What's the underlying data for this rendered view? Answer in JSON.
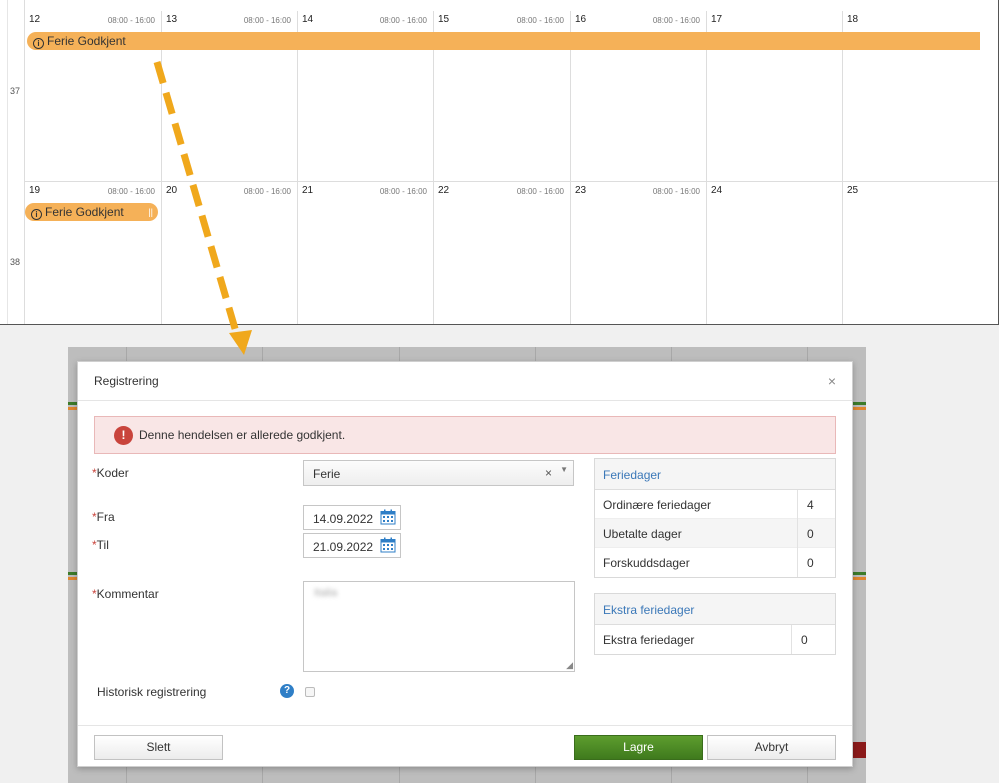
{
  "calendar": {
    "weeks": [
      {
        "number": "37",
        "days": [
          {
            "day": "12",
            "hours": "08:00 - 16:00"
          },
          {
            "day": "13",
            "hours": "08:00 - 16:00"
          },
          {
            "day": "14",
            "hours": "08:00 - 16:00"
          },
          {
            "day": "15",
            "hours": "08:00 - 16:00"
          },
          {
            "day": "16",
            "hours": "08:00 - 16:00"
          },
          {
            "day": "17",
            "hours": ""
          },
          {
            "day": "18",
            "hours": ""
          }
        ],
        "event": {
          "label": "Ferie Godkjent",
          "icon": "info-icon"
        }
      },
      {
        "number": "38",
        "days": [
          {
            "day": "19",
            "hours": "08:00 - 16:00"
          },
          {
            "day": "20",
            "hours": "08:00 - 16:00"
          },
          {
            "day": "21",
            "hours": "08:00 - 16:00"
          },
          {
            "day": "22",
            "hours": "08:00 - 16:00"
          },
          {
            "day": "23",
            "hours": "08:00 - 16:00"
          },
          {
            "day": "24",
            "hours": ""
          },
          {
            "day": "25",
            "hours": ""
          }
        ],
        "event": {
          "label": "Ferie Godkjent",
          "icon": "info-icon",
          "handle": "||"
        }
      }
    ],
    "event_color": "#f5b158",
    "arrow_color": "#f0a81c"
  },
  "modal": {
    "title": "Registrering",
    "close": "×",
    "alert": {
      "icon": "!",
      "text": "Denne hendelsen er allerede godkjent.",
      "color": "#c9443c"
    },
    "required_mark": "*",
    "fields": {
      "koder": {
        "label": "Koder",
        "value": "Ferie",
        "clear": "×",
        "caret": "▼"
      },
      "fra": {
        "label": "Fra",
        "value": "14.09.2022"
      },
      "til": {
        "label": "Til",
        "value": "21.09.2022"
      },
      "kommentar": {
        "label": "Kommentar",
        "value": "Italia"
      },
      "historisk": {
        "label": "Historisk registrering",
        "help": "?",
        "checked": false
      }
    },
    "feriedager": {
      "title": "Feriedager",
      "rows": [
        {
          "label": "Ordinære feriedager",
          "value": "4"
        },
        {
          "label": "Ubetalte dager",
          "value": "0"
        },
        {
          "label": "Forskuddsdager",
          "value": "0"
        }
      ]
    },
    "ekstra": {
      "title": "Ekstra feriedager",
      "rows": [
        {
          "label": "Ekstra feriedager",
          "value": "0"
        }
      ]
    },
    "buttons": {
      "delete": "Slett",
      "save": "Lagre",
      "cancel": "Avbryt"
    },
    "accent": "#3b78b8",
    "primary_color": "#4a8a24"
  }
}
